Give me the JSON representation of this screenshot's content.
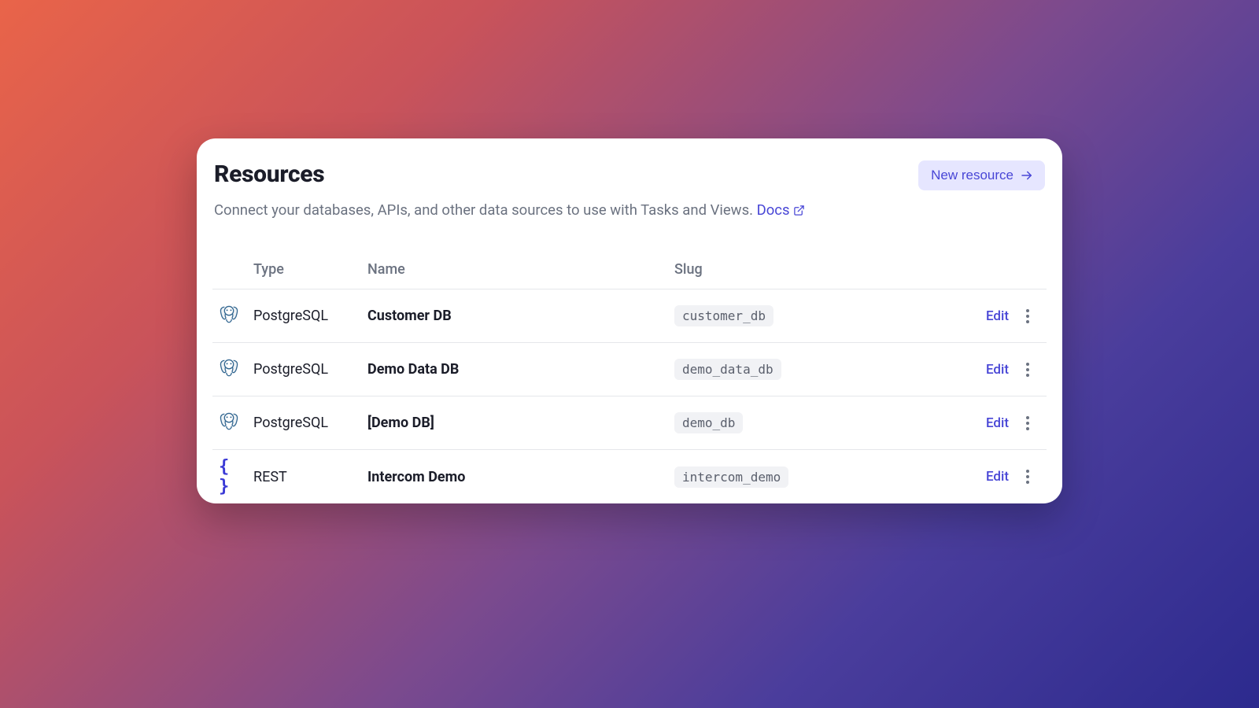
{
  "header": {
    "title": "Resources",
    "new_resource_label": "New resource"
  },
  "subtitle": {
    "text": "Connect your databases, APIs, and other data sources to use with Tasks and Views. ",
    "docs_label": "Docs"
  },
  "table": {
    "columns": {
      "type": "Type",
      "name": "Name",
      "slug": "Slug"
    },
    "rows": [
      {
        "icon": "postgres",
        "type": "PostgreSQL",
        "name": "Customer DB",
        "slug": "customer_db",
        "edit_label": "Edit"
      },
      {
        "icon": "postgres",
        "type": "PostgreSQL",
        "name": "Demo Data DB",
        "slug": "demo_data_db",
        "edit_label": "Edit"
      },
      {
        "icon": "postgres",
        "type": "PostgreSQL",
        "name": "[Demo DB]",
        "slug": "demo_db",
        "edit_label": "Edit"
      },
      {
        "icon": "rest",
        "type": "REST",
        "name": "Intercom Demo",
        "slug": "intercom_demo",
        "edit_label": "Edit"
      }
    ]
  },
  "colors": {
    "accent": "#4846d6",
    "accent_bg": "#e6e6ff",
    "text_primary": "#1b1d29",
    "text_secondary": "#6b7280",
    "badge_bg": "#f1f2f5"
  }
}
